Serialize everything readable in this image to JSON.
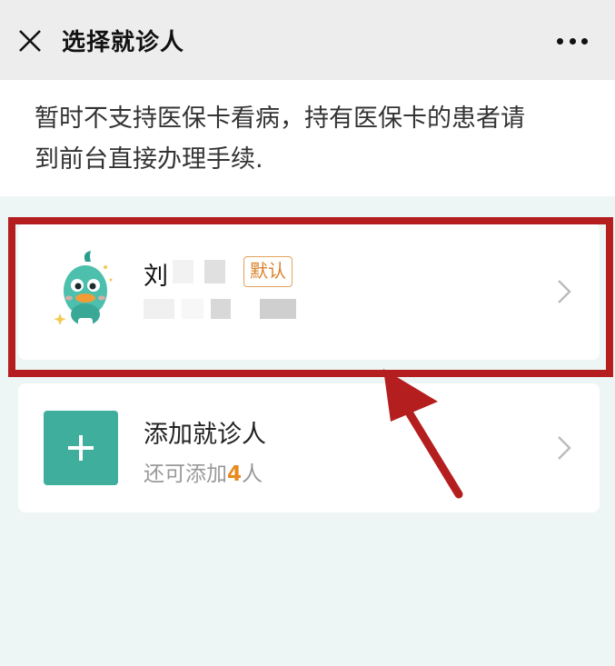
{
  "header": {
    "title": "选择就诊人",
    "close_icon": "close-icon",
    "more_icon": "more-icon"
  },
  "notice": {
    "line1": "暂时不支持医保卡看病，持有医保卡的患者请",
    "line2": "到前台直接办理手续."
  },
  "patient": {
    "surname": "刘",
    "badge": "默认",
    "avatar_icon": "duck-avatar-icon"
  },
  "add_patient": {
    "title": "添加就诊人",
    "sub_prefix": "还可添加",
    "count": "4",
    "sub_suffix": "人"
  },
  "colors": {
    "accent": "#3fae9c",
    "highlight": "#b51e1e",
    "badge": "#d9822b",
    "count": "#e8891e"
  }
}
